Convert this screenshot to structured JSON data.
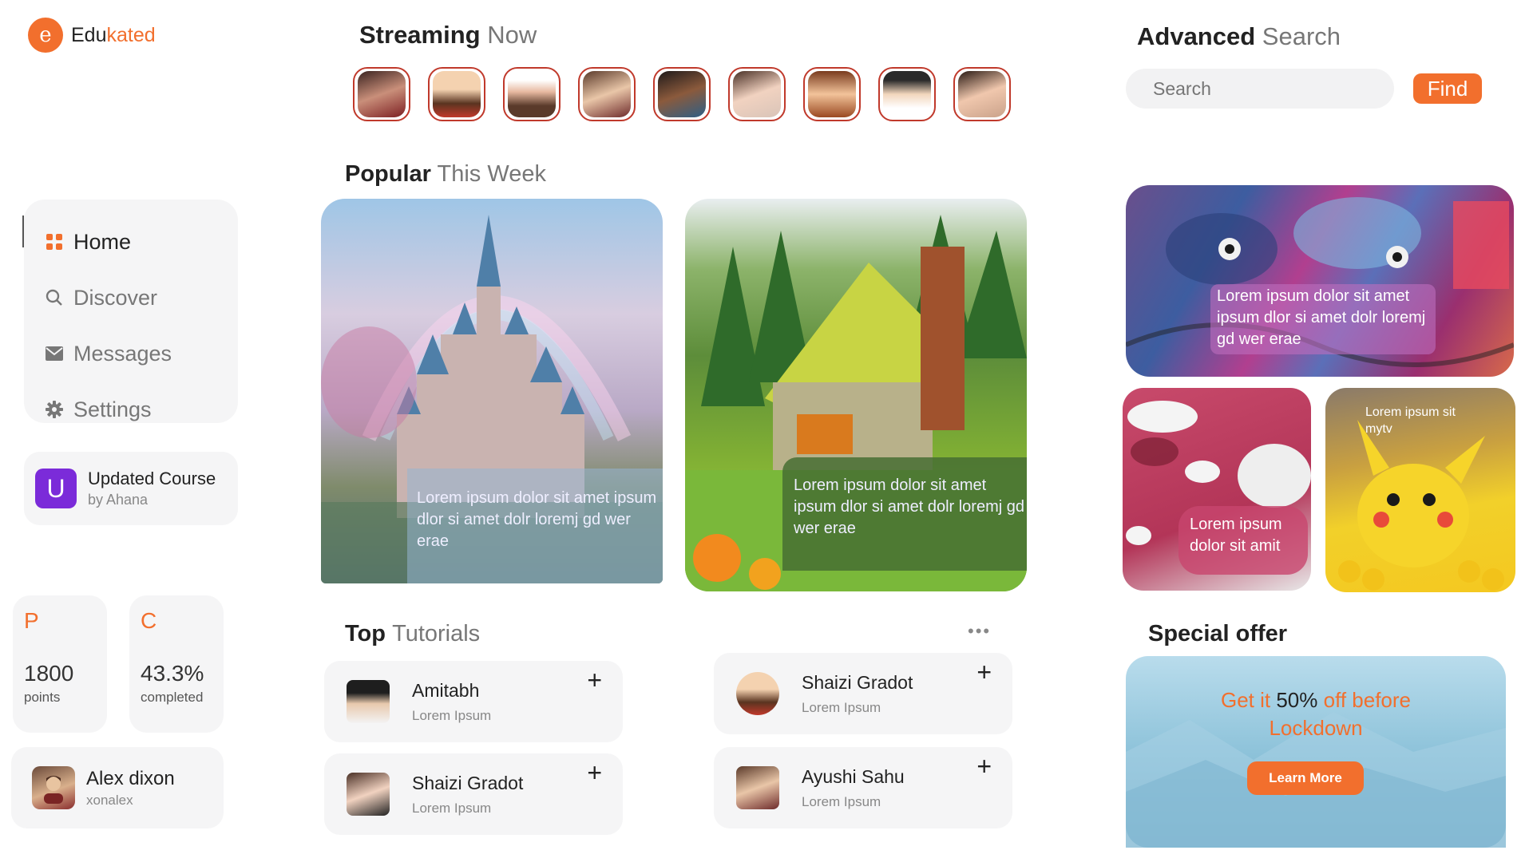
{
  "brand": {
    "mark": "e",
    "name_part1": "Edu",
    "name_part2": "kated"
  },
  "nav": {
    "items": [
      {
        "label": "Home",
        "icon": "grid-icon",
        "active": true
      },
      {
        "label": "Discover",
        "icon": "search-icon",
        "active": false
      },
      {
        "label": "Messages",
        "icon": "mail-icon",
        "active": false
      },
      {
        "label": "Settings",
        "icon": "gear-icon",
        "active": false
      }
    ]
  },
  "updated_course": {
    "badge": "U",
    "title": "Updated Course",
    "author": "by Ahana"
  },
  "stats": [
    {
      "letter": "P",
      "value": "1800",
      "label": "points"
    },
    {
      "letter": "C",
      "value": "43.3%",
      "label": "completed"
    }
  ],
  "profile": {
    "name": "Alex dixon",
    "handle": "xonalex"
  },
  "streaming": {
    "title_bold": "Streaming",
    "title_light": "Now"
  },
  "popular": {
    "title_bold": "Popular",
    "title_light1": "This",
    "title_light2": "Week"
  },
  "cards": [
    {
      "text": "Lorem ipsum dolor sit amet ipsum dlor si amet dolr loremj gd wer erae"
    },
    {
      "text": "Lorem ipsum dolor sit amet ipsum dlor si amet dolr loremj gd wer erae"
    }
  ],
  "tutorials": {
    "title_bold": "Top",
    "title_light": "Tutorials",
    "more": "•••",
    "items": [
      {
        "name": "Amitabh",
        "sub": "Lorem Ipsum"
      },
      {
        "name": "Shaizi Gradot",
        "sub": "Lorem Ipsum"
      },
      {
        "name": "Shaizi Gradot",
        "sub": "Lorem Ipsum"
      },
      {
        "name": "Ayushi Sahu",
        "sub": "Lorem Ipsum"
      }
    ],
    "add": "+"
  },
  "search": {
    "title_bold": "Advanced",
    "title_light": "Search",
    "placeholder": "Search",
    "button": "Find"
  },
  "tiles": {
    "graffiti": "Lorem ipsum dolor sit amet ipsum dlor si amet dolr loremj gd wer erae",
    "pink": "Lorem ipsum dolor sit amit",
    "pika": "Lorem ipsum sit mytv"
  },
  "special": {
    "title": "Special offer",
    "pre": "Get it",
    "highlight": "50%",
    "post": "off before",
    "line2": "Lockdown",
    "button": "Learn More"
  },
  "colors": {
    "accent": "#f26f2d",
    "badge_purple": "#7b2bd9",
    "panel": "#f5f5f6"
  }
}
